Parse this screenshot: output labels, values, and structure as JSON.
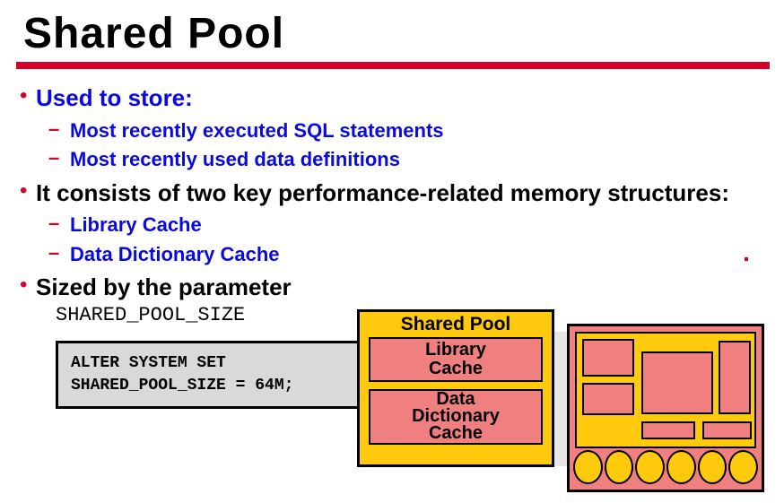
{
  "title": "Shared Pool",
  "bullets": {
    "b1": "Used to store:",
    "b1a": "Most recently executed SQL statements",
    "b1b": "Most recently used data definitions",
    "b2": "It consists of two key performance-related memory structures:",
    "b2a": "Library Cache",
    "b2b": "Data Dictionary Cache",
    "b3": "Sized by the parameter",
    "b3param": "SHARED_POOL_SIZE"
  },
  "code": {
    "line1": "ALTER SYSTEM SET",
    "line2": "SHARED_POOL_SIZE = 64M;"
  },
  "diagram": {
    "sp_title": "Shared Pool",
    "libcache_l1": "Library",
    "libcache_l2": "Cache",
    "ddcache_l1": "Data",
    "ddcache_l2": "Dictionary",
    "ddcache_l3": "Cache"
  }
}
